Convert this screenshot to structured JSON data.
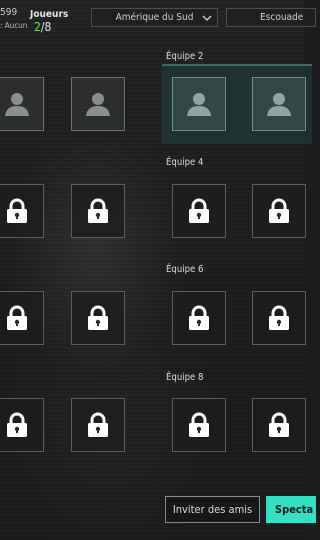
{
  "header": {
    "stat_top": "599",
    "stat_bottom": ": Aucun",
    "players_label": "Joueurs",
    "players_current": "2",
    "players_total": "/8",
    "region_value": "Amérique du Sud",
    "mode_value": "Escouade"
  },
  "teams": [
    {
      "label": "Équipe 2",
      "slots": [
        "empty",
        "empty"
      ],
      "highlighted": true
    },
    {
      "label": "Équipe 4",
      "slots": [
        "locked",
        "locked"
      ]
    },
    {
      "label": "Équipe 6",
      "slots": [
        "locked",
        "locked"
      ]
    },
    {
      "label": "Équipe 8",
      "slots": [
        "locked",
        "locked"
      ]
    }
  ],
  "left_column_slots": [
    "empty",
    "empty",
    "locked",
    "locked",
    "locked",
    "locked",
    "locked",
    "locked"
  ],
  "footer": {
    "invite_label": "Inviter des amis",
    "spectate_label": "Specta"
  },
  "colors": {
    "accent": "#34e0c2",
    "players_current": "#7fd36a",
    "team_highlight": "#214440"
  },
  "icons": {
    "empty_slot": "person-silhouette-icon",
    "locked_slot": "lock-icon",
    "dropdown": "chevron-down-icon"
  }
}
